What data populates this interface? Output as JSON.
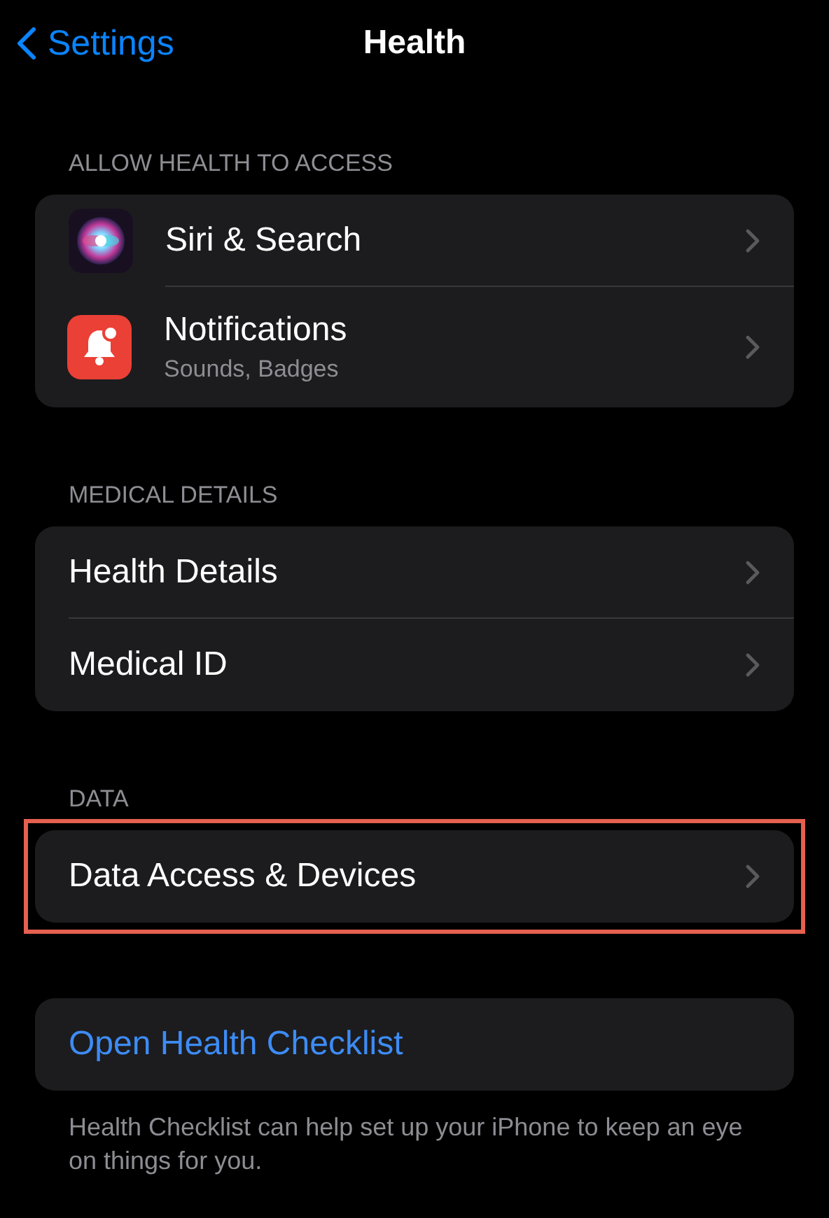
{
  "nav": {
    "back": "Settings",
    "title": "Health"
  },
  "sections": [
    {
      "header": "ALLOW HEALTH TO ACCESS",
      "highlighted": false,
      "rows": [
        {
          "kind": "app",
          "label": "Siri & Search"
        },
        {
          "kind": "app",
          "label": "Notifications",
          "subtitle": "Sounds, Badges"
        }
      ]
    },
    {
      "header": "MEDICAL DETAILS",
      "highlighted": false,
      "rows": [
        {
          "kind": "plain",
          "label": "Health Details"
        },
        {
          "kind": "plain",
          "label": "Medical ID"
        }
      ]
    },
    {
      "header": "DATA",
      "highlighted": true,
      "rows": [
        {
          "kind": "plain",
          "label": "Data Access & Devices"
        }
      ]
    },
    {
      "highlighted": false,
      "rows": [
        {
          "kind": "link",
          "label": "Open Health Checklist"
        }
      ],
      "footer": "Health Checklist can help set up your iPhone to keep an eye on things for you."
    }
  ]
}
